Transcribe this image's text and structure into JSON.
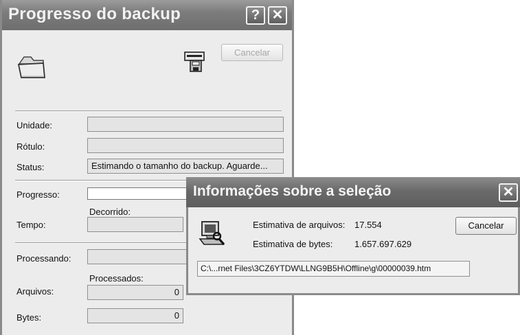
{
  "backup_window": {
    "title": "Progresso do backup",
    "help_button": "?",
    "close_button": "✕",
    "cancel_label": "Cancelar",
    "labels": {
      "drive": "Unidade:",
      "label": "Rótulo:",
      "status": "Status:",
      "progress": "Progresso:",
      "elapsed": "Decorrido:",
      "time": "Tempo:",
      "processing": "Processando:",
      "processed": "Processados:",
      "files": "Arquivos:",
      "bytes": "Bytes:"
    },
    "values": {
      "drive": "",
      "label": "",
      "status": "Estimando o tamanho do backup. Aguarde...",
      "progress_fraction": 0,
      "time": "",
      "processing": "",
      "files": "0",
      "bytes": "0"
    },
    "icons": [
      "folder-icon",
      "backup-drive-icon"
    ]
  },
  "selection_window": {
    "title": "Informações sobre a seleção",
    "close_button": "✕",
    "files_estimate_label": "Estimativa de arquivos:",
    "files_estimate_value": "17.554",
    "bytes_estimate_label": "Estimativa de bytes:",
    "bytes_estimate_value": "1.657.697.629",
    "cancel_label": "Cancelar",
    "current_path": "C:\\...rnet Files\\3CZ6YTDW\\LLNG9B5H\\Offline\\g\\00000039.htm",
    "icons": [
      "computer-scan-icon"
    ]
  }
}
